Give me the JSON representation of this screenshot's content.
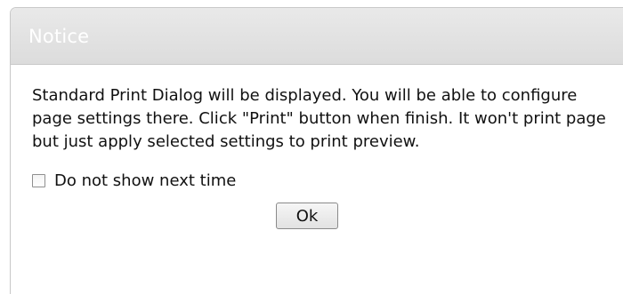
{
  "dialog": {
    "title": "Notice",
    "message": "Standard Print Dialog will be displayed. You will be able to configure page settings there. Click \"Print\" button when finish. It won't print page but just apply selected settings to print preview.",
    "checkbox": {
      "label": "Do not show next time",
      "checked": false
    },
    "ok_button_label": "Ok"
  },
  "colors": {
    "header_background": "#dcdcdc",
    "title_text": "#ffffff",
    "body_text": "#111111",
    "border": "#c8c8c8"
  }
}
